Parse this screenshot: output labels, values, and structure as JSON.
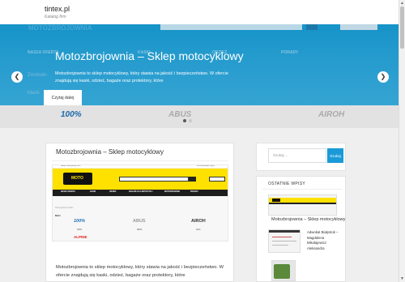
{
  "site": {
    "title": "tintex.pl",
    "tagline": "Katalog firm"
  },
  "hero": {
    "bg_logo_text": "MOTOZBROJOWNIA",
    "menu": [
      "NASZA OFERTA",
      "KASKI",
      "ODZIEŻ",
      "PORADY"
    ],
    "faded_left": "Zmotodo",
    "faded_left2": "Marki",
    "brands": [
      "100%",
      "ABUS",
      "AIROH"
    ],
    "slide_title": "Motozbrojownia – Sklep motocyklowy",
    "slide_text": "Motozbrojownia to sklep motocyklowy, który stawia na jakość i bezpieczeństwo. W ofercie znajdują się kaski, odzież, bagaże oraz protektory, które",
    "slide_button": "Czytaj dalej",
    "prev_symbol": "❮",
    "next_symbol": "❯",
    "dots": 2,
    "active_dot": 1
  },
  "article": {
    "title": "Motozbrojownia – Sklep motocyklowy",
    "text": "Motozbrojownia to sklep motocyklowy, który stawia na jakość i bezpieczeństwo. W ofercie znajdują się kaski, odzież, bagaże oraz protektory, które",
    "screenshot": {
      "topbar_left": "Sklep motocyklowy Film",
      "topbar_right": "Pomoc/kontakt  Log in",
      "logo": "MOTO",
      "nav": [
        "NASZA OFERTA",
        "KASKI",
        "ODZIEŻ",
        "BAGAŻE DLA MOTOCYKLI",
        "MOTOPORADNIK",
        "PORADY"
      ],
      "breadcrumb": "Strona główna  /  Marki",
      "section": "Marki",
      "brands_row1": [
        "100%",
        "ABUS",
        "AIROH"
      ],
      "brands_row1_caps": [
        "100%",
        "ABUS",
        "Airoh"
      ],
      "brands_row2": [
        "ALPINE"
      ]
    }
  },
  "sidebar": {
    "search_placeholder": "Szukaj ...",
    "search_button": "Szukaj",
    "recent_title": "OSTATNIE WPISY",
    "recent": [
      {
        "title": "Motozbrojownia – Sklep motocyklowy"
      },
      {
        "title": "Adwokat Białystok – Magdalena Mikołajewicz Aleksandra"
      }
    ]
  },
  "colors": {
    "accent": "#1b9ad8",
    "moto_yellow": "#ffe100"
  }
}
